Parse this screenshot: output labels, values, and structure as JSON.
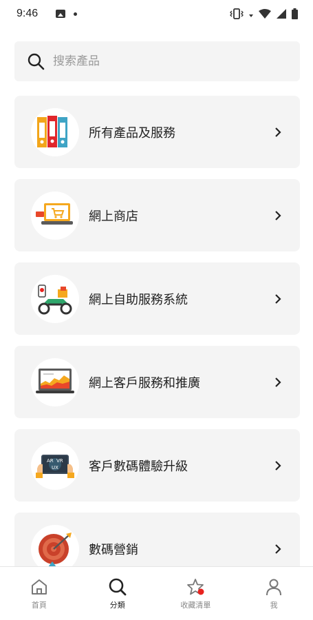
{
  "status_bar": {
    "time": "9:46"
  },
  "search": {
    "placeholder": "搜索產品"
  },
  "categories": [
    {
      "label": "所有產品及服務",
      "icon": "binders-icon"
    },
    {
      "label": "網上商店",
      "icon": "laptop-cart-icon"
    },
    {
      "label": "網上自助服務系統",
      "icon": "delivery-scooter-icon"
    },
    {
      "label": "網上客戶服務和推廣",
      "icon": "laptop-chart-icon"
    },
    {
      "label": "客戶數碼體驗升級",
      "icon": "ar-vr-ux-tablet-icon"
    },
    {
      "label": "數碼營銷",
      "icon": "target-dart-icon"
    }
  ],
  "bottom_nav": {
    "items": [
      {
        "label": "首頁",
        "icon": "home-icon"
      },
      {
        "label": "分類",
        "icon": "search-icon",
        "active": true
      },
      {
        "label": "收藏清單",
        "icon": "star-icon",
        "badge": true
      },
      {
        "label": "我",
        "icon": "user-icon"
      }
    ]
  },
  "colors": {
    "card_bg": "#f4f4f4",
    "badge_red": "#e8231f",
    "text_dark": "#222222",
    "text_muted": "#888888"
  }
}
